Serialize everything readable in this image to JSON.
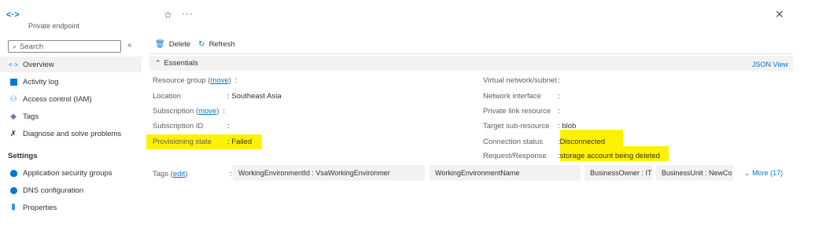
{
  "header": {
    "subtitle": "Private endpoint",
    "icon": "private-endpoint-icon"
  },
  "sidebar": {
    "search_placeholder": "Search",
    "items": [
      {
        "label": "Overview",
        "icon": "overview-icon",
        "active": true
      },
      {
        "label": "Activity log",
        "icon": "activity-log-icon"
      },
      {
        "label": "Access control (IAM)",
        "icon": "iam-icon"
      },
      {
        "label": "Tags",
        "icon": "tag-icon"
      },
      {
        "label": "Diagnose and solve problems",
        "icon": "wrench-icon"
      }
    ],
    "settings_heading": "Settings",
    "settings_items": [
      {
        "label": "Application security groups",
        "icon": "shield-icon"
      },
      {
        "label": "DNS configuration",
        "icon": "dns-icon"
      },
      {
        "label": "Properties",
        "icon": "properties-icon"
      }
    ]
  },
  "toolbar": {
    "delete_label": "Delete",
    "refresh_label": "Refresh"
  },
  "essentials": {
    "title": "Essentials",
    "json_view": "JSON View",
    "left": [
      {
        "label": "Resource group",
        "link": "move",
        "value": ""
      },
      {
        "label": "Location",
        "value": "Southeast Asia"
      },
      {
        "label": "Subscription",
        "link": "move",
        "value": ""
      },
      {
        "label": "Subscription ID",
        "value": ""
      },
      {
        "label": "Provisioning state",
        "value": "Failed"
      }
    ],
    "right": [
      {
        "label": "Virtual network/subnet",
        "value": ""
      },
      {
        "label": "Network interface",
        "value": ""
      },
      {
        "label": "Private link resource",
        "value": ""
      },
      {
        "label": "Target sub-resource",
        "value": "blob"
      },
      {
        "label": "Connection status",
        "value": "Disconnected"
      },
      {
        "label": "Request/Response",
        "value": "storage account being deleted"
      }
    ],
    "highlight_color": "#fff200"
  },
  "tags": {
    "label": "Tags",
    "edit_link": "edit",
    "items": [
      "WorkingEnvironmentId : VsaWorkingEnvironmer",
      "WorkingEnvironmentName",
      "BusinessOwner : IT",
      "BusinessUnit : NewCo"
    ],
    "more": "More (17)"
  }
}
